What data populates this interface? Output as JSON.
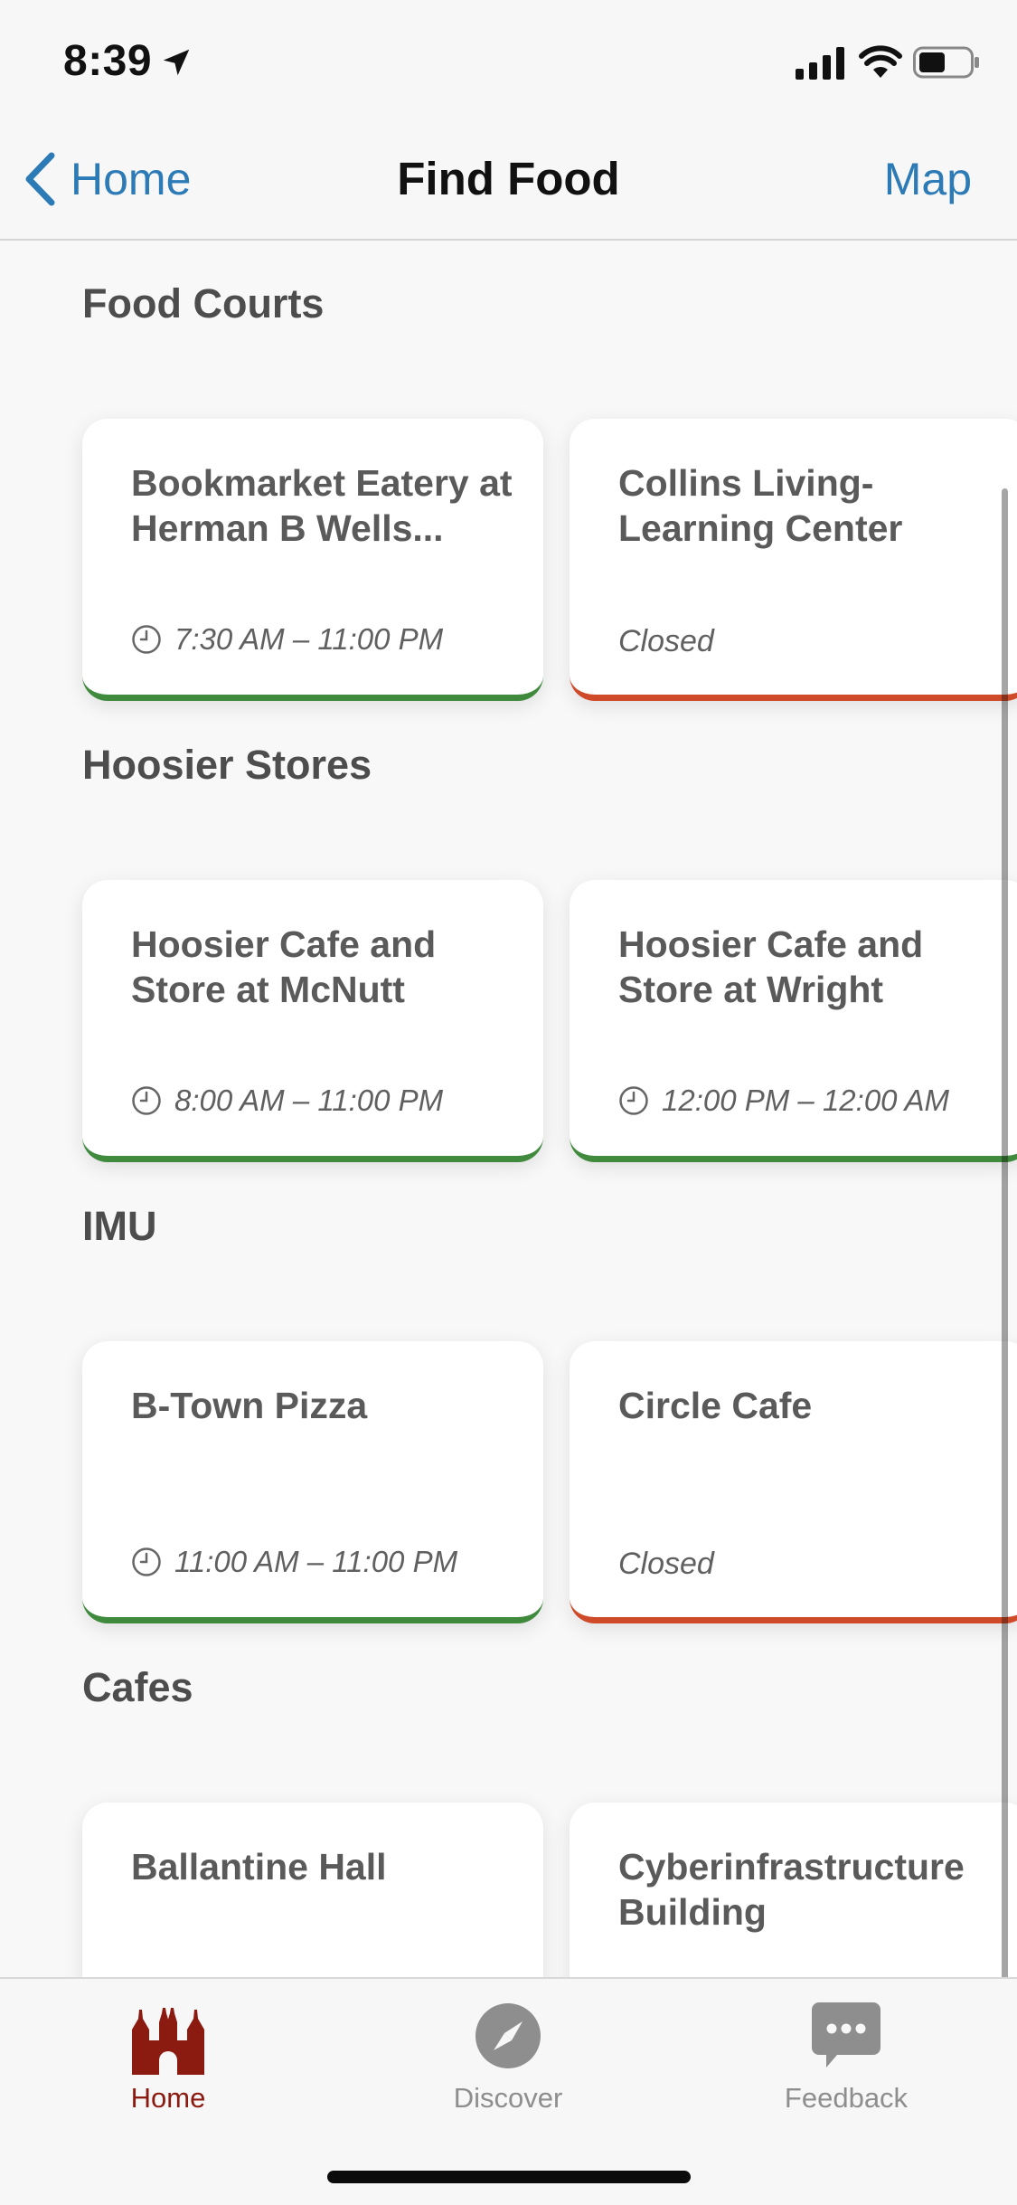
{
  "status_bar": {
    "time": "8:39",
    "icons": [
      "location-arrow-icon",
      "cellular-signal-icon",
      "wifi-icon",
      "battery-icon"
    ]
  },
  "nav": {
    "back_label": "Home",
    "title": "Find Food",
    "right_label": "Map"
  },
  "sections": [
    {
      "title": "Food Courts",
      "cards": [
        {
          "name": "Bookmarket Eatery at Herman B Wells...",
          "hours": "7:30 AM – 11:00 PM",
          "status": "open"
        },
        {
          "name": "Collins Living-Learning Center",
          "status_label": "Closed",
          "status": "closed"
        }
      ]
    },
    {
      "title": "Hoosier Stores",
      "cards": [
        {
          "name": "Hoosier Cafe and Store at McNutt",
          "hours": "8:00 AM – 11:00 PM",
          "status": "open"
        },
        {
          "name": "Hoosier Cafe and Store at Wright",
          "hours": "12:00 PM – 12:00 AM",
          "status": "open"
        }
      ]
    },
    {
      "title": "IMU",
      "cards": [
        {
          "name": "B-Town Pizza",
          "hours": "11:00 AM – 11:00 PM",
          "status": "open"
        },
        {
          "name": "Circle Cafe",
          "status_label": "Closed",
          "status": "closed"
        }
      ]
    },
    {
      "title": "Cafes",
      "cards": [
        {
          "name": "Ballantine Hall"
        },
        {
          "name": "Cyberinfrastructure Building"
        }
      ]
    }
  ],
  "tab_bar": {
    "tabs": [
      {
        "label": "Home",
        "icon": "home-towers-icon",
        "selected": true
      },
      {
        "label": "Discover",
        "icon": "compass-icon",
        "selected": false
      },
      {
        "label": "Feedback",
        "icon": "chat-bubble-icon",
        "selected": false
      }
    ]
  },
  "colors": {
    "accent_blue": "#2c7bb6",
    "open_green": "#3f8a3c",
    "closed_red": "#cf4a28",
    "brand_crimson": "#8b1a10"
  }
}
